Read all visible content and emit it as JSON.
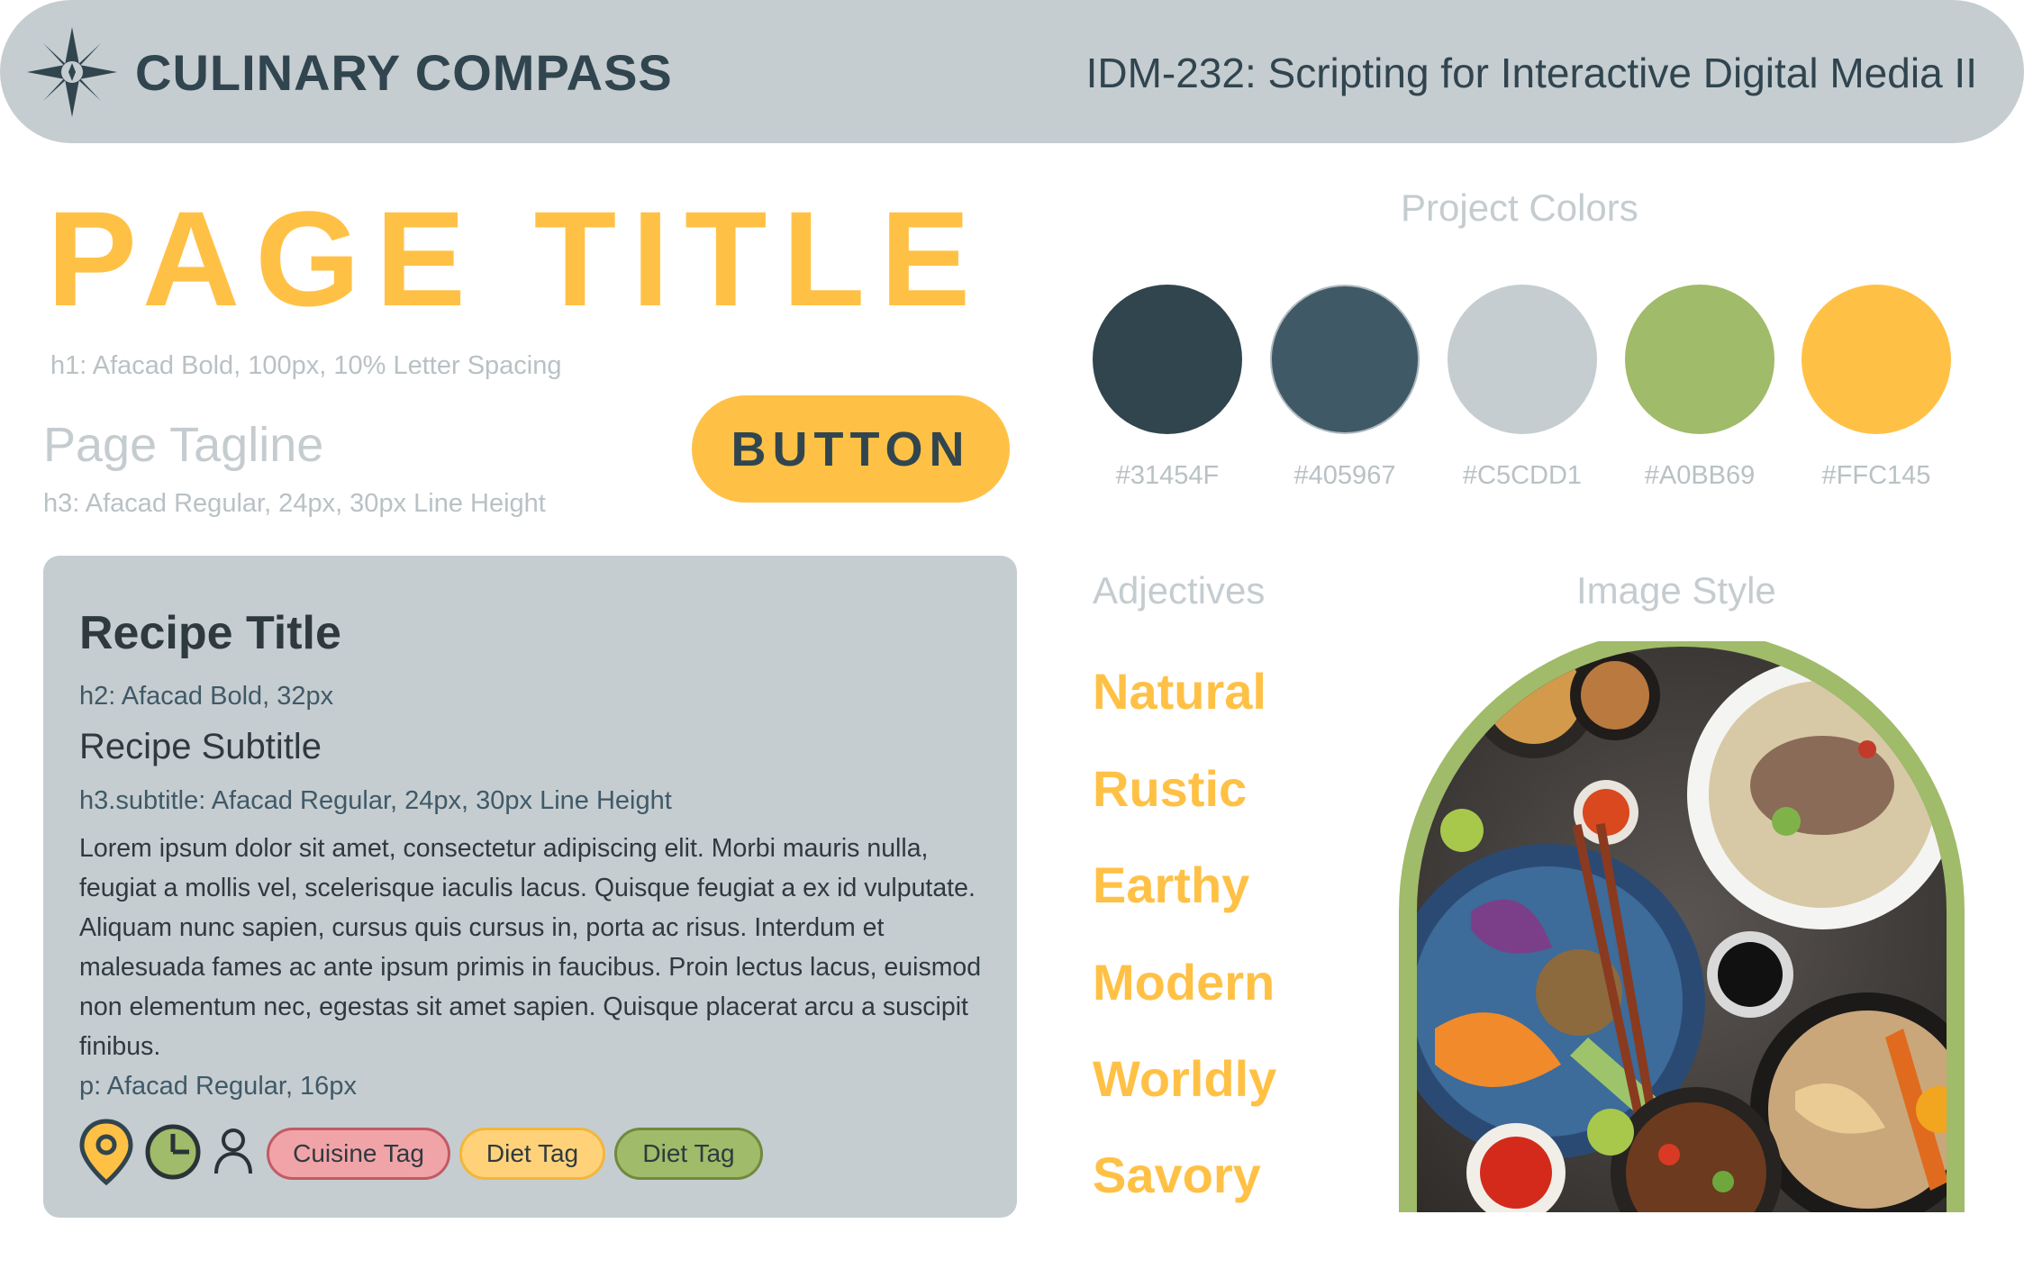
{
  "header": {
    "brand": "CULINARY COMPASS",
    "course": "IDM-232: Scripting for Interactive Digital Media II",
    "logo_icon": "compass-rose-icon"
  },
  "typography": {
    "page_title": "PAGE TITLE",
    "h1_caption": "h1: Afacad Bold, 100px, 10% Letter Spacing",
    "tagline": "Page Tagline",
    "h3_caption": "h3: Afacad Regular, 24px, 30px Line Height",
    "button_label": "BUTTON"
  },
  "recipe_card": {
    "title": "Recipe Title",
    "title_caption": "h2: Afacad Bold, 32px",
    "subtitle": "Recipe Subtitle",
    "subtitle_caption": "h3.subtitle: Afacad Regular, 24px, 30px Line Height",
    "body": "Lorem ipsum dolor sit amet, consectetur adipiscing elit. Morbi mauris nulla, feugiat a mollis vel, scelerisque iaculis lacus. Quisque feugiat a ex id vulputate. Aliquam nunc sapien, cursus quis cursus in, porta ac risus. Interdum et malesuada fames ac ante ipsum primis in faucibus. Proin lectus lacus, euismod non elementum nec, egestas sit amet sapien. Quisque placerat arcu a suscipit finibus.",
    "body_caption": "p: Afacad Regular, 16px",
    "icons": [
      "location-pin-icon",
      "clock-icon",
      "person-icon"
    ],
    "tags": [
      "Cuisine Tag",
      "Diet Tag",
      "Diet Tag"
    ]
  },
  "project_colors": {
    "title": "Project Colors",
    "swatches": [
      {
        "hex": "#31454F",
        "label": "#31454F"
      },
      {
        "hex": "#405967",
        "label": "#405967"
      },
      {
        "hex": "#C5CDD1",
        "label": "#C5CDD1"
      },
      {
        "hex": "#A0BB69",
        "label": "#A0BB69"
      },
      {
        "hex": "#FFC145",
        "label": "#FFC145"
      }
    ]
  },
  "adjectives": {
    "title": "Adjectives",
    "items": [
      "Natural",
      "Rustic",
      "Earthy",
      "Modern",
      "Worldly",
      "Savory"
    ]
  },
  "image_style": {
    "title": "Image Style"
  }
}
